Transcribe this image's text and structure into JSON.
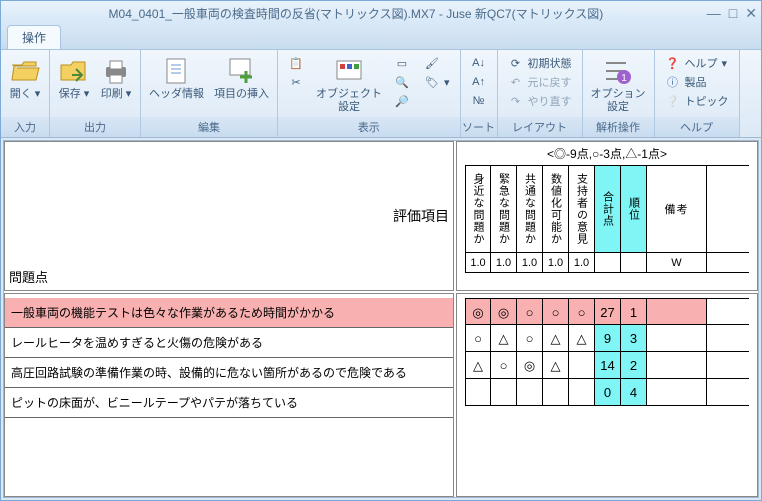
{
  "window": {
    "title": "M04_0401_一般車両の検査時間の反省(マトリックス図).MX7 - Juse 新QC7(マトリックス図)"
  },
  "tab": {
    "label": "操作"
  },
  "ribbon": {
    "input": {
      "label": "入力",
      "open": "開く"
    },
    "output": {
      "label": "出力",
      "save": "保存",
      "print": "印刷"
    },
    "edit": {
      "label": "編集",
      "header_info": "ヘッダ情報",
      "insert_item": "項目の挿入"
    },
    "display": {
      "label": "表示",
      "object_settings": "オブジェクト\n設定"
    },
    "sort": {
      "label": "ソート",
      "sort": "ソート"
    },
    "layout": {
      "label": "レイアウト",
      "initial": "初期状態",
      "undo": "元に戻す",
      "redo": "やり直す"
    },
    "analysis": {
      "label": "解析操作",
      "option_settings": "オプション\n設定"
    },
    "help": {
      "label": "ヘルプ",
      "help": "ヘルプ",
      "product": "製品",
      "topic": "トピック"
    }
  },
  "headers": {
    "eval_items": "評価項目",
    "problem": "問題点",
    "scoring": "<◎-9点,○-3点,△-1点>",
    "columns": [
      "身近な問題か",
      "緊急な問題か",
      "共通な問題か",
      "数値化可能か",
      "支持者の意見",
      "合計点",
      "順位",
      "備考"
    ],
    "weights": [
      "1.0",
      "1.0",
      "1.0",
      "1.0",
      "1.0",
      "",
      "",
      "W"
    ]
  },
  "rows": [
    "一般車両の機能テストは色々な作業があるため時間がかかる",
    "レールヒータを温めすぎると火傷の危険がある",
    "高圧回路試験の準備作業の時、設備的に危ない箇所があるので危険である",
    "ピットの床面が、ビニールテープやパテが落ちている"
  ],
  "matrix": [
    {
      "marks": [
        "◎",
        "◎",
        "○",
        "○",
        "○"
      ],
      "total": "27",
      "rank": "1",
      "note": ""
    },
    {
      "marks": [
        "○",
        "△",
        "○",
        "△",
        "△"
      ],
      "total": "9",
      "rank": "3",
      "note": ""
    },
    {
      "marks": [
        "△",
        "○",
        "◎",
        "△",
        ""
      ],
      "total": "14",
      "rank": "2",
      "note": ""
    },
    {
      "marks": [
        "",
        "",
        "",
        "",
        ""
      ],
      "total": "0",
      "rank": "4",
      "note": ""
    }
  ],
  "selected_row": 0
}
